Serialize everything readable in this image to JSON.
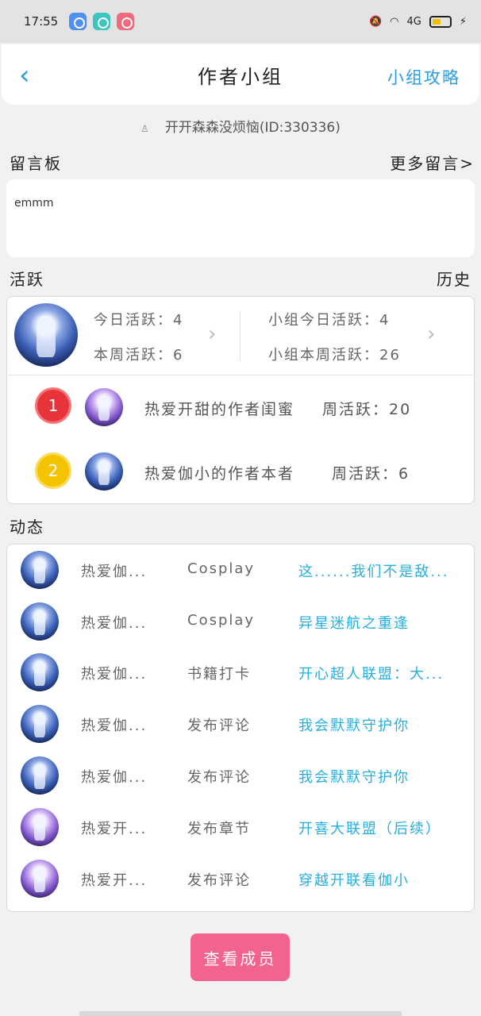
{
  "status": {
    "time": "17:55",
    "network": "4G"
  },
  "header": {
    "back": "‹",
    "title": "作者小组",
    "guide": "小组攻略"
  },
  "owner": "开开森森没烦恼(ID:330336)",
  "message_board": {
    "label": "留言板",
    "more": "更多留言>",
    "content": "emmm"
  },
  "activity": {
    "label": "活跃",
    "history": "历史",
    "today": "今日活跃：4",
    "week": "本周活跃：6",
    "group_today": "小组今日活跃：4",
    "group_week": "小组本周活跃：26",
    "ranks": [
      {
        "rank": "1",
        "name": "热爱开甜的作者闺蜜",
        "score": "周活跃：20"
      },
      {
        "rank": "2",
        "name": "热爱伽小的作者本者",
        "score": "周活跃：6"
      }
    ]
  },
  "feed": {
    "label": "动态",
    "items": [
      {
        "name": "热爱伽...",
        "type": "Cosplay",
        "link": "这......我们不是敌..."
      },
      {
        "name": "热爱伽...",
        "type": "Cosplay",
        "link": "异星迷航之重逢"
      },
      {
        "name": "热爱伽...",
        "type": "书籍打卡",
        "link": "开心超人联盟：大..."
      },
      {
        "name": "热爱伽...",
        "type": "发布评论",
        "link": "我会默默守护你"
      },
      {
        "name": "热爱伽...",
        "type": "发布评论",
        "link": "我会默默守护你"
      },
      {
        "name": "热爱开...",
        "type": "发布章节",
        "link": "开喜大联盟（后续）"
      },
      {
        "name": "热爱开...",
        "type": "发布评论",
        "link": "穿越开联看伽小"
      }
    ]
  },
  "view_members": "查看成员",
  "colors": {
    "accent": "#2a9de3",
    "link": "#27aee0",
    "button": "#f2648f"
  }
}
